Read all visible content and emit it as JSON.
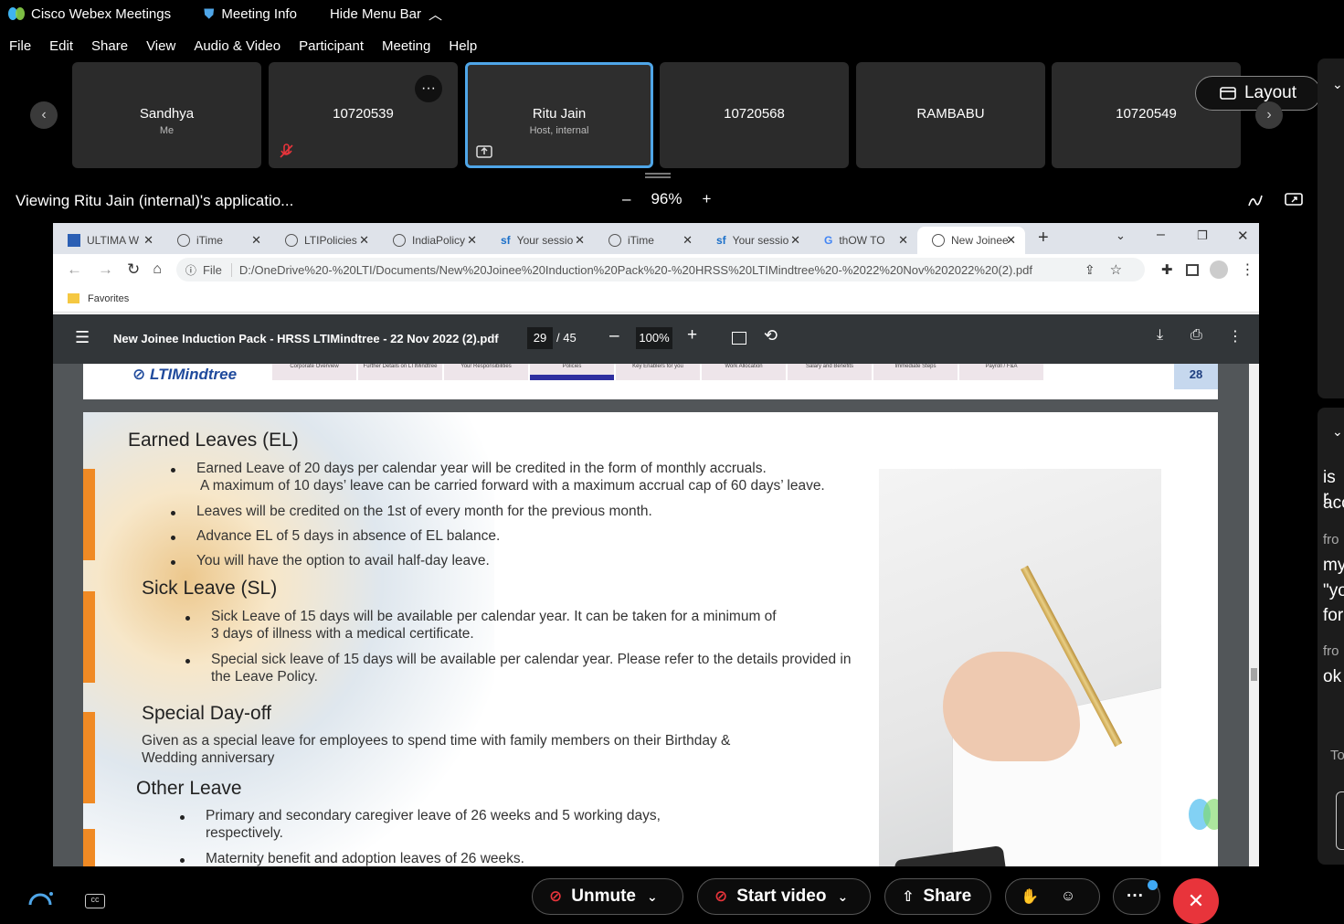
{
  "titlebar": {
    "app": "Cisco Webex Meetings",
    "meeting_info": "Meeting Info",
    "hide_menu": "Hide Menu Bar"
  },
  "menu": [
    "File",
    "Edit",
    "Share",
    "View",
    "Audio & Video",
    "Participant",
    "Meeting",
    "Help"
  ],
  "participants": [
    {
      "name": "Sandhya",
      "sub": "Me"
    },
    {
      "name": "10720539",
      "sub": ""
    },
    {
      "name": "Ritu Jain",
      "sub": "Host, internal"
    },
    {
      "name": "10720568",
      "sub": ""
    },
    {
      "name": "RAMBABU",
      "sub": ""
    },
    {
      "name": "10720549",
      "sub": ""
    }
  ],
  "layout_label": "Layout",
  "viewing_label": "Viewing Ritu Jain (internal)'s applicatio...",
  "zoom": {
    "minus": "–",
    "value": "96%",
    "plus": "+"
  },
  "browser": {
    "tabs": [
      "ULTIMA W",
      "iTime",
      "LTIPolicies",
      "IndiaPolicy",
      "Your sessio",
      "iTime",
      "Your sessio",
      "thOW TO",
      "New Joinee"
    ],
    "file_label": "File",
    "url": "D:/OneDrive%20-%20LTI/Documents/New%20Joinee%20Induction%20Pack%20-%20HRSS%20LTIMindtree%20-%2022%20Nov%202022%20(2).pdf",
    "favorites": "Favorites"
  },
  "pdf": {
    "title": "New Joinee Induction Pack - HRSS LTIMindtree - 22 Nov 2022 (2).pdf",
    "page_current": "29",
    "page_total": "/ 45",
    "zoom": "100%",
    "slide_page_number": "28",
    "brand": "LTIMindtree",
    "nav_items": [
      "Corporate Overview",
      "Further Details on LTIMindtree",
      "Your Responsibilities",
      "Policies",
      "Key Enablers for you",
      "Work Allocation",
      "Salary and Benefits",
      "Immediate Steps",
      "Payroll / F&A"
    ]
  },
  "slide": {
    "el_heading": "Earned Leaves (EL)",
    "el_1a": "Earned Leave of 20 days per calendar year will be credited in the form of monthly accruals.",
    "el_1b": "A maximum of 10 days’ leave can be carried forward with a maximum accrual cap of 60 days’ leave.",
    "el_2": "Leaves will be credited on the 1st of every month for the previous month.",
    "el_3": "Advance EL of 5 days in absence of EL balance.",
    "el_4": "You will have the option to avail half-day leave.",
    "sl_heading": "Sick Leave (SL)",
    "sl_1a": "Sick Leave of 15 days will be available per calendar year. It can be taken for a minimum of",
    "sl_1b": "3 days of illness with a medical certificate.",
    "sl_2a": "Special sick leave of 15 days will be available per calendar year. Please refer to the details provided in",
    "sl_2b": "the Leave Policy.",
    "sd_heading": "Special Day-off",
    "sd_1a": "Given as a special leave for employees to spend time with family members on their Birthday &",
    "sd_1b": "Wedding anniversary",
    "ol_heading": "Other Leave",
    "ol_1a": "Primary and secondary caregiver leave of 26 weeks and 5 working days,",
    "ol_1b": "respectively.",
    "ol_2": "Maternity benefit and adoption leaves of 26 weeks."
  },
  "chat_fragments": [
    "is r",
    "acc",
    "fro",
    "my",
    "\"yo",
    "for",
    "fro",
    "ok",
    "To"
  ],
  "controls": {
    "unmute": "Unmute",
    "start_video": "Start video",
    "share": "Share"
  },
  "colors": {
    "accent": "#4fa6e8",
    "end": "#e8343b",
    "orange": "#f08a24"
  }
}
